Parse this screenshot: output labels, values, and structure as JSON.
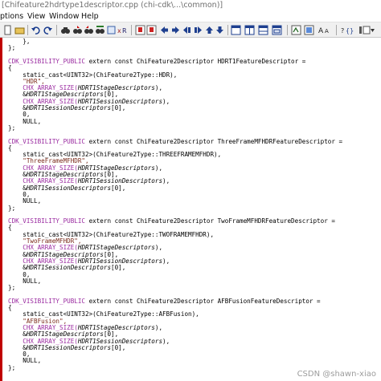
{
  "window": {
    "title": "[Chifeature2hdrtype1descriptor.cpp (chi-cdk\\...\\common)]"
  },
  "menu": {
    "items": [
      "ptions",
      "View",
      "Window",
      "Help"
    ]
  },
  "toolbar": {
    "icons": [
      "new-file-icon",
      "open-file-icon",
      "undo-icon",
      "redo-icon",
      "find-icon",
      "find-next-icon",
      "find-prev-icon",
      "replace-icon",
      "goto-icon",
      "x-r-icon",
      "bookmark-icon",
      "bookmark-next-icon",
      "nav-back-icon",
      "nav-forward-icon",
      "jump-icon",
      "jump-back-icon",
      "nav-up-icon",
      "nav-down-icon",
      "window-tile-icon",
      "window-list-icon",
      "window-split-icon",
      "window-cascade-icon",
      "symbol-icon",
      "class-icon",
      "font-size-icon",
      "go-definition-icon",
      "context-icon"
    ]
  },
  "code": {
    "lines": [
      {
        "parts": [
          {
            "t": "    },",
            "c": "ident"
          }
        ]
      },
      {
        "parts": [
          {
            "t": "};",
            "c": "ident"
          }
        ]
      },
      {
        "parts": [
          {
            "t": "",
            "c": "ident"
          }
        ]
      },
      {
        "parts": [
          {
            "t": "CDK_VISIBILITY_PUBLIC",
            "c": "kw"
          },
          {
            "t": " extern const ChiFeature2Descriptor ",
            "c": "ident"
          },
          {
            "t": "HDRT1FeatureDescriptor",
            "c": "ident"
          },
          {
            "t": " =",
            "c": "ident"
          }
        ]
      },
      {
        "parts": [
          {
            "t": "{",
            "c": "ident"
          }
        ]
      },
      {
        "parts": [
          {
            "t": "    static_cast<UINT32>(ChiFeature2Type::HDR),",
            "c": "ident"
          }
        ]
      },
      {
        "parts": [
          {
            "t": "    \"HDR\",",
            "c": "str"
          }
        ]
      },
      {
        "parts": [
          {
            "t": "    CHX_ARRAY_SIZE(",
            "c": "kw"
          },
          {
            "t": "HDRT1StageDescriptors",
            "c": "ital"
          },
          {
            "t": "),",
            "c": "ident"
          }
        ]
      },
      {
        "parts": [
          {
            "t": "    &",
            "c": "ident"
          },
          {
            "t": "HDRT1StageDescriptors",
            "c": "ital"
          },
          {
            "t": "[0],",
            "c": "ident"
          }
        ]
      },
      {
        "parts": [
          {
            "t": "    CHX_ARRAY_SIZE(",
            "c": "kw"
          },
          {
            "t": "HDRT1SessionDescriptors",
            "c": "ital"
          },
          {
            "t": "),",
            "c": "ident"
          }
        ]
      },
      {
        "parts": [
          {
            "t": "    &",
            "c": "ident"
          },
          {
            "t": "HDRT1SessionDescriptors",
            "c": "ital"
          },
          {
            "t": "[0],",
            "c": "ident"
          }
        ]
      },
      {
        "parts": [
          {
            "t": "    0,",
            "c": "ident"
          }
        ]
      },
      {
        "parts": [
          {
            "t": "    NULL,",
            "c": "ident"
          }
        ]
      },
      {
        "parts": [
          {
            "t": "};",
            "c": "ident"
          }
        ]
      },
      {
        "parts": [
          {
            "t": "",
            "c": "ident"
          }
        ]
      },
      {
        "parts": [
          {
            "t": "CDK_VISIBILITY_PUBLIC",
            "c": "kw"
          },
          {
            "t": " extern const ChiFeature2Descriptor ",
            "c": "ident"
          },
          {
            "t": "ThreeFrameMFHDRFeatureDescriptor",
            "c": "ident"
          },
          {
            "t": " =",
            "c": "ident"
          }
        ]
      },
      {
        "parts": [
          {
            "t": "{",
            "c": "ident"
          }
        ]
      },
      {
        "parts": [
          {
            "t": "    static_cast<UINT32>(ChiFeature2Type::THREEFRAMEMFHDR),",
            "c": "ident"
          }
        ]
      },
      {
        "parts": [
          {
            "t": "    \"ThreeFrameMFHDR\",",
            "c": "str"
          }
        ]
      },
      {
        "parts": [
          {
            "t": "    CHX_ARRAY_SIZE(",
            "c": "kw"
          },
          {
            "t": "HDRT1StageDescriptors",
            "c": "ital"
          },
          {
            "t": "),",
            "c": "ident"
          }
        ]
      },
      {
        "parts": [
          {
            "t": "    &",
            "c": "ident"
          },
          {
            "t": "HDRT1StageDescriptors",
            "c": "ital"
          },
          {
            "t": "[0],",
            "c": "ident"
          }
        ]
      },
      {
        "parts": [
          {
            "t": "    CHX_ARRAY_SIZE(",
            "c": "kw"
          },
          {
            "t": "HDRT1SessionDescriptors",
            "c": "ital"
          },
          {
            "t": "),",
            "c": "ident"
          }
        ]
      },
      {
        "parts": [
          {
            "t": "    &",
            "c": "ident"
          },
          {
            "t": "HDRT1SessionDescriptors",
            "c": "ital"
          },
          {
            "t": "[0],",
            "c": "ident"
          }
        ]
      },
      {
        "parts": [
          {
            "t": "    0,",
            "c": "ident"
          }
        ]
      },
      {
        "parts": [
          {
            "t": "    NULL,",
            "c": "ident"
          }
        ]
      },
      {
        "parts": [
          {
            "t": "};",
            "c": "ident"
          }
        ]
      },
      {
        "parts": [
          {
            "t": "",
            "c": "ident"
          }
        ]
      },
      {
        "parts": [
          {
            "t": "CDK_VISIBILITY_PUBLIC",
            "c": "kw"
          },
          {
            "t": " extern const ChiFeature2Descriptor ",
            "c": "ident"
          },
          {
            "t": "TwoFrameMFHDRFeatureDescriptor",
            "c": "ident"
          },
          {
            "t": " =",
            "c": "ident"
          }
        ]
      },
      {
        "parts": [
          {
            "t": "{",
            "c": "ident"
          }
        ]
      },
      {
        "parts": [
          {
            "t": "    static_cast<UINT32>(ChiFeature2Type::TWOFRAMEMFHDR),",
            "c": "ident"
          }
        ]
      },
      {
        "parts": [
          {
            "t": "    \"TwoFrameMFHDR\",",
            "c": "str"
          }
        ]
      },
      {
        "parts": [
          {
            "t": "    CHX_ARRAY_SIZE(",
            "c": "kw"
          },
          {
            "t": "HDRT1StageDescriptors",
            "c": "ital"
          },
          {
            "t": "),",
            "c": "ident"
          }
        ]
      },
      {
        "parts": [
          {
            "t": "    &",
            "c": "ident"
          },
          {
            "t": "HDRT1StageDescriptors",
            "c": "ital"
          },
          {
            "t": "[0],",
            "c": "ident"
          }
        ]
      },
      {
        "parts": [
          {
            "t": "    CHX_ARRAY_SIZE(",
            "c": "kw"
          },
          {
            "t": "HDRT1SessionDescriptors",
            "c": "ital"
          },
          {
            "t": "),",
            "c": "ident"
          }
        ]
      },
      {
        "parts": [
          {
            "t": "    &",
            "c": "ident"
          },
          {
            "t": "HDRT1SessionDescriptors",
            "c": "ital"
          },
          {
            "t": "[0],",
            "c": "ident"
          }
        ]
      },
      {
        "parts": [
          {
            "t": "    0,",
            "c": "ident"
          }
        ]
      },
      {
        "parts": [
          {
            "t": "    NULL,",
            "c": "ident"
          }
        ]
      },
      {
        "parts": [
          {
            "t": "};",
            "c": "ident"
          }
        ]
      },
      {
        "parts": [
          {
            "t": "",
            "c": "ident"
          }
        ]
      },
      {
        "parts": [
          {
            "t": "CDK_VISIBILITY_PUBLIC",
            "c": "kw"
          },
          {
            "t": " extern const ChiFeature2Descriptor ",
            "c": "ident"
          },
          {
            "t": "AFBFusionFeatureDescriptor",
            "c": "ident"
          },
          {
            "t": " =",
            "c": "ident"
          }
        ]
      },
      {
        "parts": [
          {
            "t": "{",
            "c": "ident"
          }
        ]
      },
      {
        "parts": [
          {
            "t": "    static_cast<UINT32>(ChiFeature2Type::AFBFusion),",
            "c": "ident"
          }
        ]
      },
      {
        "parts": [
          {
            "t": "    \"AFBFusion\",",
            "c": "str"
          }
        ]
      },
      {
        "parts": [
          {
            "t": "    CHX_ARRAY_SIZE(",
            "c": "kw"
          },
          {
            "t": "HDRT1StageDescriptors",
            "c": "ital"
          },
          {
            "t": "),",
            "c": "ident"
          }
        ]
      },
      {
        "parts": [
          {
            "t": "    &",
            "c": "ident"
          },
          {
            "t": "HDRT1StageDescriptors",
            "c": "ital"
          },
          {
            "t": "[0],",
            "c": "ident"
          }
        ]
      },
      {
        "parts": [
          {
            "t": "    CHX_ARRAY_SIZE(",
            "c": "kw"
          },
          {
            "t": "HDRT1SessionDescriptors",
            "c": "ital"
          },
          {
            "t": "),",
            "c": "ident"
          }
        ]
      },
      {
        "parts": [
          {
            "t": "    &",
            "c": "ident"
          },
          {
            "t": "HDRT1SessionDescriptors",
            "c": "ital"
          },
          {
            "t": "[0],",
            "c": "ident"
          }
        ]
      },
      {
        "parts": [
          {
            "t": "    0,",
            "c": "ident"
          }
        ]
      },
      {
        "parts": [
          {
            "t": "    NULL,",
            "c": "ident"
          }
        ]
      },
      {
        "parts": [
          {
            "t": "};",
            "c": "ident"
          }
        ]
      }
    ]
  },
  "watermark": "CSDN @shawn-xiao"
}
